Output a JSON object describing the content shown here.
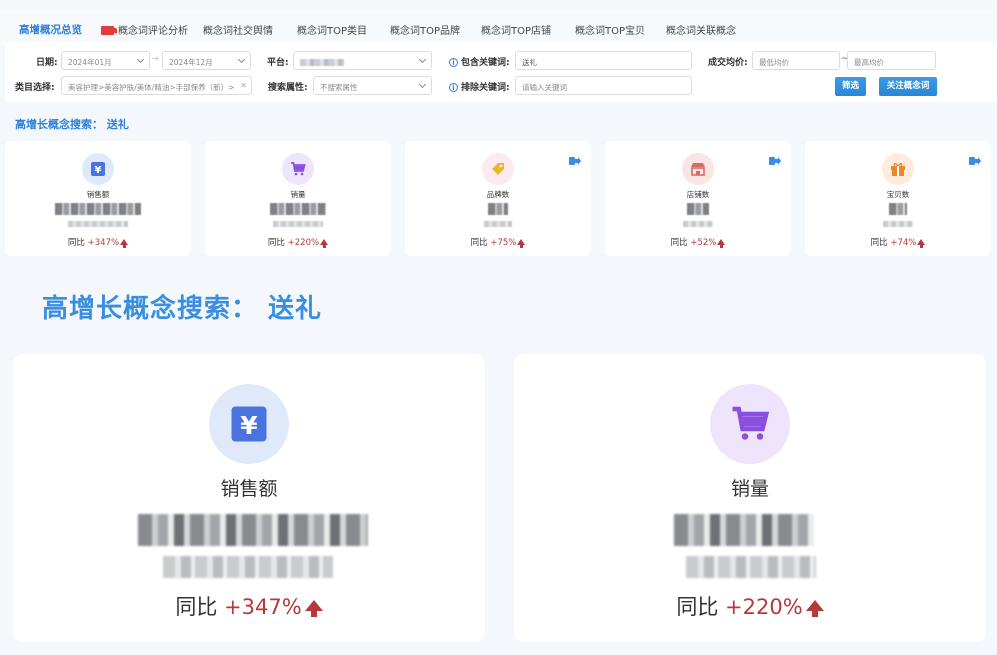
{
  "tabs": [
    {
      "label": "高增概况总览",
      "active": true
    },
    {
      "label": "概念词评论分析",
      "badge": true
    },
    {
      "label": "概念词社交舆情"
    },
    {
      "label": "概念词TOP类目"
    },
    {
      "label": "概念词TOP品牌"
    },
    {
      "label": "概念词TOP店铺"
    },
    {
      "label": "概念词TOP宝贝"
    },
    {
      "label": "概念词关联概念"
    }
  ],
  "filters": {
    "date_label": "日期:",
    "date_start": "2024年01月",
    "date_sep": "→",
    "date_end": "2024年12月",
    "platform_label": "平台:",
    "include_label": "包含关键词:",
    "include_value": "送礼",
    "price_label": "成交均价:",
    "price_min_placeholder": "最低均价",
    "price_tilde": "~",
    "price_max_placeholder": "最高均价",
    "category_label": "类目选择:",
    "category_value": "美容护理>美容护肤/美体/精油>手部保养（新）>",
    "attr_label": "搜索属性:",
    "attr_value": "不搜索属性",
    "exclude_label": "排除关键词:",
    "exclude_placeholder": "请输入关键词",
    "filter_button": "筛选",
    "follow_button": "关注概念词"
  },
  "section_small_title": "高增长概念搜索：  送礼",
  "small_cards": [
    {
      "title": "销售额",
      "yoy_label": "同比",
      "yoy_value": "+347%",
      "icon": "yen-icon",
      "icon_bg": "#dfe9f9",
      "icon_color": "#4b73e0"
    },
    {
      "title": "销量",
      "yoy_label": "同比",
      "yoy_value": "+220%",
      "icon": "cart-icon",
      "icon_bg": "#eee4fb",
      "icon_color": "#8a4fe0"
    },
    {
      "title": "品牌数",
      "yoy_label": "同比",
      "yoy_value": "+75%",
      "icon": "tag-icon",
      "icon_bg": "#fbeaf0",
      "icon_color": "#f0b428"
    },
    {
      "title": "店铺数",
      "yoy_label": "同比",
      "yoy_value": "+52%",
      "icon": "store-icon",
      "icon_bg": "#fbe4e4",
      "icon_color": "#d86a6a"
    },
    {
      "title": "宝贝数",
      "yoy_label": "同比",
      "yoy_value": "+74%",
      "icon": "gift-icon",
      "icon_bg": "#fdebdd",
      "icon_color": "#e88a2a"
    }
  ],
  "section_big_title": "高增长概念搜索：  送礼",
  "big_cards": [
    {
      "title": "销售额",
      "yoy_label": "同比",
      "yoy_value": "+347%",
      "icon": "yen-icon",
      "icon_bg": "#dfe9f9",
      "icon_color": "#4b73e0"
    },
    {
      "title": "销量",
      "yoy_label": "同比",
      "yoy_value": "+220%",
      "icon": "cart-icon",
      "icon_bg": "#eee4fb",
      "icon_color": "#8a4fe0"
    }
  ],
  "colors": {
    "accent": "#2f7fd8",
    "increase": "#b4393c"
  }
}
